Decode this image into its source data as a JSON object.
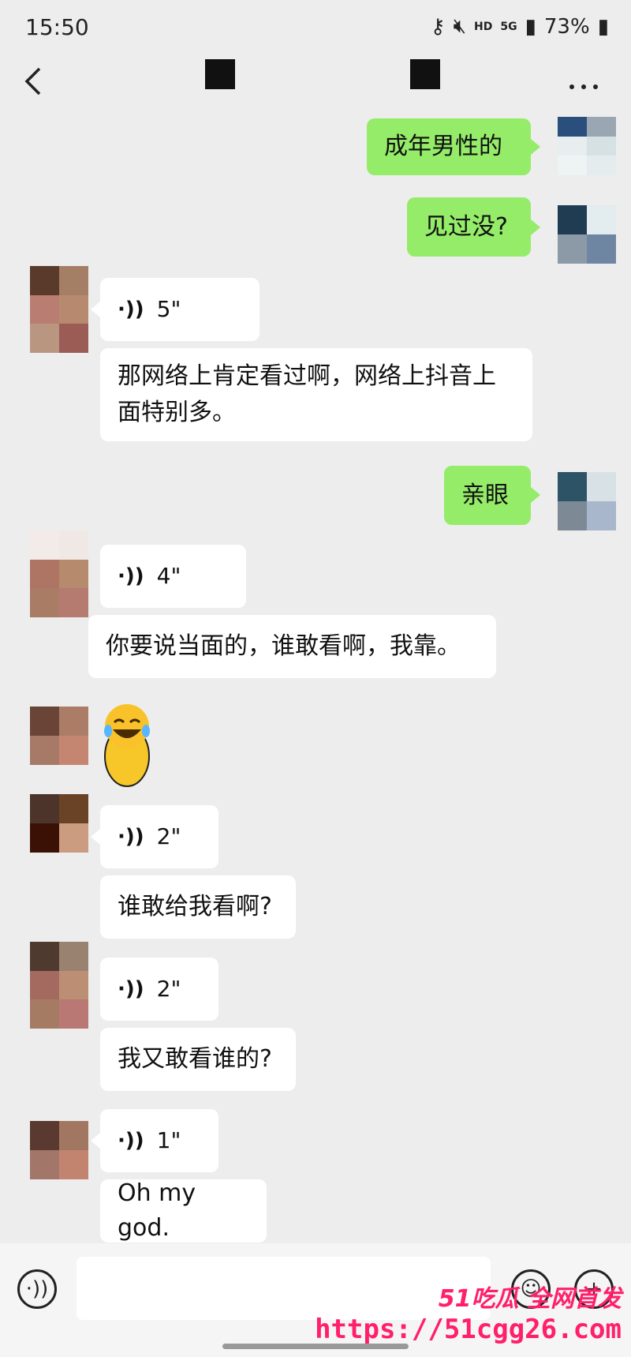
{
  "status_bar": {
    "time": "15:50",
    "network": "5G",
    "hd": "HD",
    "battery": "73%"
  },
  "navbar": {
    "back_icon": "chevron-left-icon",
    "more_icon": "more-dots-icon"
  },
  "messages": [
    {
      "side": "me",
      "type": "text",
      "text": "成年男性的"
    },
    {
      "side": "me",
      "type": "text",
      "text": "见过没?"
    },
    {
      "side": "other",
      "type": "voice",
      "duration": "5\""
    },
    {
      "side": "other",
      "type": "text",
      "text": "那网络上肯定看过啊，网络上抖音上面特别多。"
    },
    {
      "side": "me",
      "type": "text",
      "text": "亲眼"
    },
    {
      "side": "other",
      "type": "voice",
      "duration": "4\""
    },
    {
      "side": "other",
      "type": "text",
      "text": "你要说当面的，谁敢看啊，我靠。"
    },
    {
      "side": "other",
      "type": "emoji",
      "emoji": "😂"
    },
    {
      "side": "other",
      "type": "voice",
      "duration": "2\""
    },
    {
      "side": "other",
      "type": "text",
      "text": "谁敢给我看啊?"
    },
    {
      "side": "other",
      "type": "voice",
      "duration": "2\""
    },
    {
      "side": "other",
      "type": "text",
      "text": "我又敢看谁的?"
    },
    {
      "side": "other",
      "type": "voice",
      "duration": "1\""
    },
    {
      "side": "other",
      "type": "text",
      "text": "Oh my god."
    }
  ],
  "watermark": {
    "line1": "51吃瓜 全网首发",
    "line2": "https://51cgg26.com"
  },
  "colors": {
    "my_bubble": "#95ec69",
    "other_bubble": "#ffffff",
    "background": "#ededed"
  }
}
